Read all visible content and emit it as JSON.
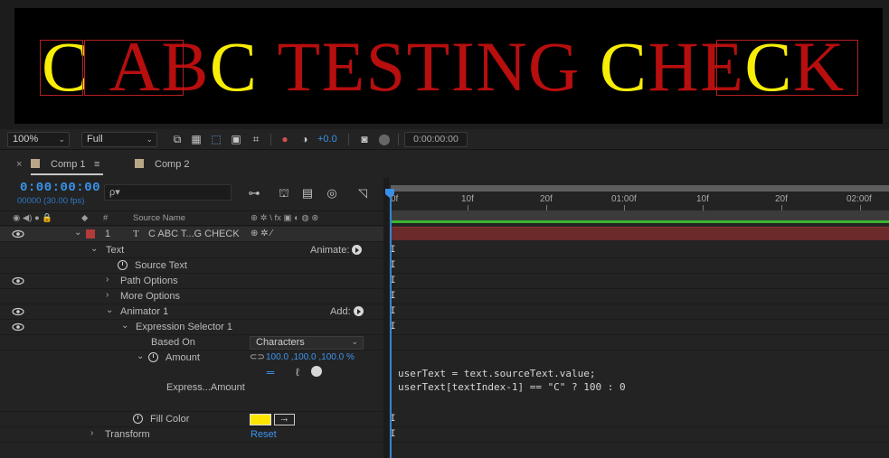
{
  "composition_text": {
    "parts": [
      {
        "text": "C",
        "highlight": true
      },
      {
        "text": " A",
        "highlight": false
      },
      {
        "text": "B",
        "highlight": false
      },
      {
        "text": "C",
        "highlight": true
      },
      {
        "text": " TESTING ",
        "highlight": false
      },
      {
        "text": "C",
        "highlight": true
      },
      {
        "text": "H",
        "highlight": false
      },
      {
        "text": "E",
        "highlight": false
      },
      {
        "text": "C",
        "highlight": true
      },
      {
        "text": "K",
        "highlight": false
      }
    ],
    "highlight_color": "#f7ed07",
    "base_color": "#b70e0e"
  },
  "viewer_toolbar": {
    "zoom": "100%",
    "resolution": "Full",
    "exposure": "+0.0",
    "time": "0:00:00:00"
  },
  "tabs": [
    {
      "label": "Comp 1",
      "active": true,
      "close": "×",
      "menu": "≡"
    },
    {
      "label": "Comp 2",
      "active": false
    }
  ],
  "timeline": {
    "timecode": "0:00:00:00",
    "fps": "00000 (30.00 fps)",
    "search_placeholder": "ρ▾",
    "column_headers": {
      "num": "#",
      "source_name": "Source Name",
      "switches": "⊕ ✲ \\ fx ▣ ◐ ◍ ⊗"
    }
  },
  "layer": {
    "number": "1",
    "type_icon": "T",
    "name": "C ABC T...G CHECK",
    "label_color": "#b23a3a"
  },
  "properties": {
    "text": "Text",
    "animate": "Animate:",
    "source_text": "Source Text",
    "path_options": "Path Options",
    "more_options": "More Options",
    "animator": "Animator 1",
    "add": "Add:",
    "expression_selector": "Expression Selector 1",
    "based_on": "Based On",
    "based_on_value": "Characters",
    "amount": "Amount",
    "amount_value": "100.0 ,100.0 ,100.0 %",
    "express_amount": "Express...Amount",
    "fill_color": "Fill Color",
    "fill_swatch": "#ffe600",
    "transform": "Transform",
    "reset": "Reset"
  },
  "ruler_labels": [
    "0f",
    "10f",
    "20f",
    "01:00f",
    "10f",
    "20f",
    "02:00f"
  ],
  "expression": {
    "line1": "userText = text.sourceText.value;",
    "line2": "userText[textIndex-1] == \"C\" ? 100 : 0"
  }
}
